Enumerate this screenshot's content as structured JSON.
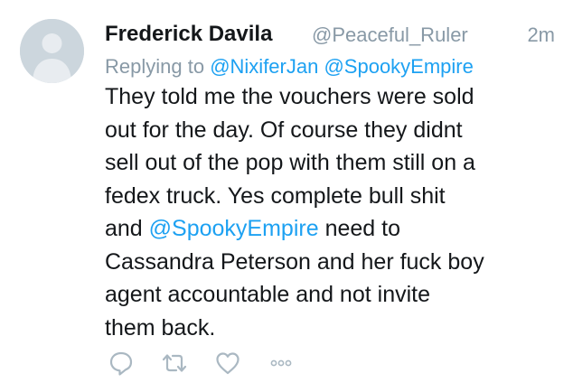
{
  "tweet": {
    "display_name": "Frederick Davila",
    "handle": "@Peaceful_Ruler",
    "timestamp": "2m",
    "replying_prefix": "Replying to",
    "replying_to": [
      "@NixiferJan",
      "@SpookyEmpire"
    ],
    "body_lines": [
      "They told me the vouchers were sold",
      "out for the day. Of course they didnt",
      "sell out of the pop with them still on a",
      "fedex truck. Yes complete bull shit",
      "and",
      "@SpookyEmpire",
      "need to",
      "Cassandra Peterson and her fuck boy",
      "agent accountable and not invite",
      "them back."
    ]
  },
  "actions": {
    "icons": [
      "reply-icon",
      "retweet-icon",
      "like-icon",
      "more-icon"
    ]
  },
  "colors": {
    "text": "#14171a",
    "secondary": "#8899a6",
    "link": "#1da1f2",
    "icon": "#aab8c2",
    "avatar_bg": "#ccd6dd"
  }
}
